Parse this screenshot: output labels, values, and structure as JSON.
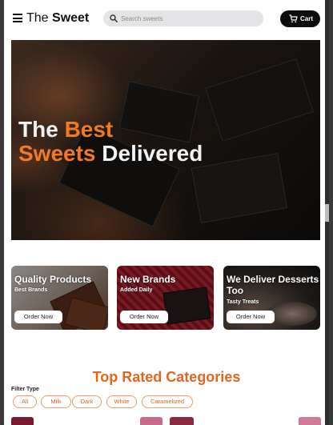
{
  "header": {
    "brand_light": "The ",
    "brand_bold": "Sweet",
    "search_placeholder": "Search sweets",
    "cart_label": "Cart"
  },
  "hero": {
    "line1_a": "The ",
    "line1_b": "Best",
    "line2_a": "Sweets",
    "line2_b": " Delivered"
  },
  "promos": [
    {
      "title": "Quality Products",
      "subtitle": "Best Brands",
      "button": "Order Now"
    },
    {
      "title": "New Brands",
      "subtitle": "Added Daily",
      "button": "Order Now"
    },
    {
      "title": "We Deliver Desserts Too",
      "subtitle": "Tasty Treats",
      "button": "Order Now"
    }
  ],
  "categories": {
    "title": "Top Rated Categories",
    "filter_label": "Filter Type",
    "filters": [
      "All",
      "Milk",
      "Dark",
      "White",
      "Caramelized"
    ]
  },
  "colors": {
    "accent": "#e2661d",
    "hero_highlight": "#f07a25",
    "cart_button": "#0c0c0c"
  },
  "icons": [
    "menu-icon",
    "search-icon",
    "cart-icon"
  ]
}
